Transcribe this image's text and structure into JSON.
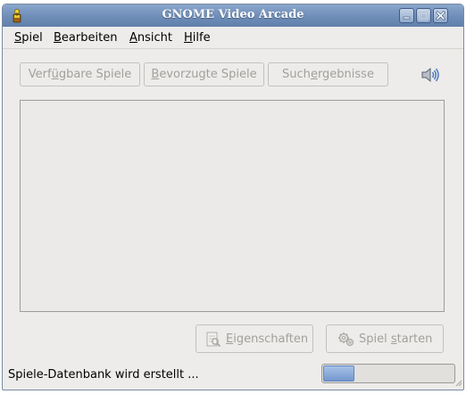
{
  "window": {
    "title": "GNOME Video Arcade"
  },
  "menubar": {
    "items": [
      {
        "mnemonic": "S",
        "rest": "piel"
      },
      {
        "mnemonic": "B",
        "rest": "earbeiten"
      },
      {
        "mnemonic": "A",
        "rest": "nsicht"
      },
      {
        "mnemonic": "H",
        "rest": "ilfe"
      }
    ]
  },
  "view_tabs": {
    "available": {
      "pre": "Verf",
      "mnemonic": "ü",
      "post": "gbare Spiele"
    },
    "favorites": {
      "pre": "",
      "mnemonic": "B",
      "post": "evorzugte Spiele"
    },
    "search": {
      "pre": "Such",
      "mnemonic": "e",
      "post": "rgebnisse"
    }
  },
  "actions": {
    "properties": {
      "pre": "",
      "mnemonic": "E",
      "post": "igenschaften"
    },
    "start": {
      "pre": "Spiel ",
      "mnemonic": "s",
      "post": "tarten"
    }
  },
  "status": {
    "text": "Spiele-Datenbank wird erstellt ...",
    "progress_fraction": 0.24
  },
  "colors": {
    "titlebar": "#6e8db7",
    "window_bg": "#edeceb",
    "disabled_text": "#a3a09b",
    "progress_fill": "#7397cf"
  },
  "icons": {
    "app": "arcade-joystick-icon",
    "sound": "speaker-volume-icon",
    "properties": "properties-icon",
    "start": "start-game-icon"
  }
}
